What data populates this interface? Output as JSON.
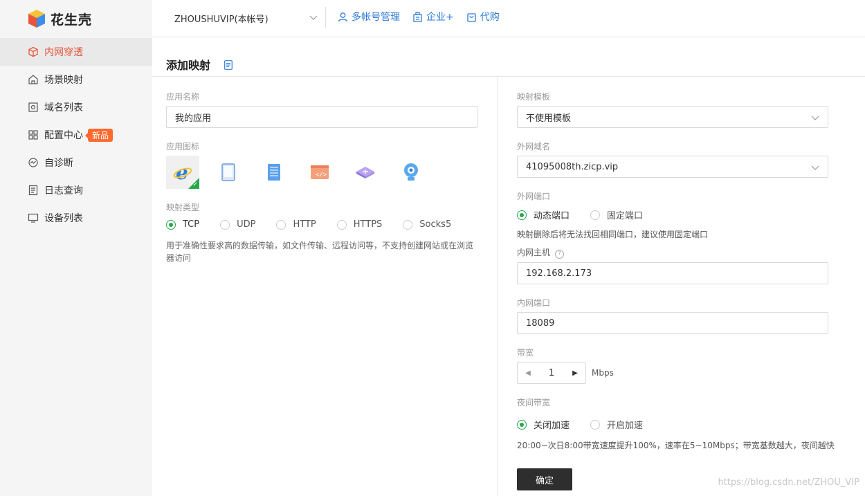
{
  "app": {
    "name": "花生壳"
  },
  "sidebar": {
    "items": [
      {
        "label": "内网穿透",
        "icon": "cube-icon",
        "active": true
      },
      {
        "label": "场景映射",
        "icon": "house-icon"
      },
      {
        "label": "域名列表",
        "icon": "domain-icon"
      },
      {
        "label": "配置中心",
        "icon": "grid-icon",
        "badge": "新品"
      },
      {
        "label": "自诊断",
        "icon": "diagnose-icon"
      },
      {
        "label": "日志查询",
        "icon": "log-icon"
      },
      {
        "label": "设备列表",
        "icon": "monitor-icon"
      }
    ]
  },
  "header": {
    "account": "ZHOUSHUVIP(本帐号)",
    "links": [
      {
        "label": "多帐号管理",
        "icon": "user-icon"
      },
      {
        "label": "企业+",
        "icon": "enterprise-icon"
      },
      {
        "label": "代购",
        "icon": "bag-icon"
      }
    ]
  },
  "page": {
    "title": "添加映射"
  },
  "left": {
    "app_name_label": "应用名称",
    "app_name_value": "我的应用",
    "app_icon_label": "应用图标",
    "app_icons": [
      "ie-icon",
      "tablet-icon",
      "server-icon",
      "code-window-icon",
      "router-icon",
      "camera-icon"
    ],
    "map_type_label": "映射类型",
    "map_types": [
      "TCP",
      "UDP",
      "HTTP",
      "HTTPS",
      "Socks5"
    ],
    "map_type_selected": "TCP",
    "description": "用于准确性要求高的数据传输，如文件传输、远程访问等，不支持创建网站或在浏览器访问"
  },
  "right": {
    "template_label": "映射模板",
    "template_value": "不使用模板",
    "domain_label": "外网域名",
    "domain_value": "41095008th.zicp.vip",
    "port_label": "外网端口",
    "port_options": [
      "动态端口",
      "固定端口"
    ],
    "port_selected": "动态端口",
    "port_note": "映射删除后将无法找回相同端口，建议使用固定端口",
    "host_label": "内网主机",
    "host_help": "?",
    "host_value": "192.168.2.173",
    "inner_port_label": "内网端口",
    "inner_port_value": "18089",
    "bandwidth_label": "带宽",
    "bandwidth_value": "1",
    "bandwidth_unit": "Mbps",
    "night_label": "夜间带宽",
    "night_options": [
      "关闭加速",
      "开启加速"
    ],
    "night_selected": "关闭加速",
    "night_note": "20:00~次日8:00带宽速度提升100%，速率在5~10Mbps；带宽基数越大，夜间越快",
    "confirm_label": "确定"
  },
  "watermark": "https://blog.csdn.net/ZHOU_VIP",
  "colors": {
    "accent": "#e8553a",
    "link": "#2d7bd8",
    "radio": "#27a84a",
    "badge": "#ff6a2e",
    "button": "#2e2e2e"
  }
}
